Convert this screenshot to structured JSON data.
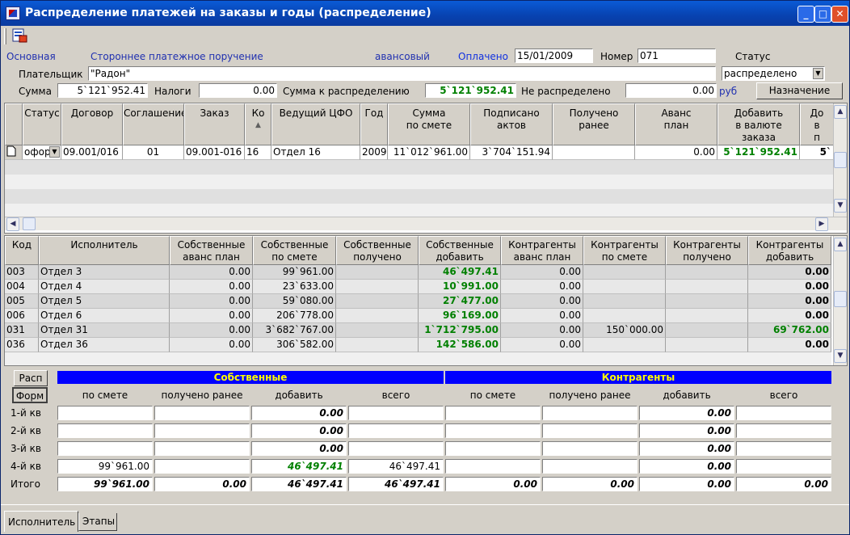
{
  "window": {
    "title": "Распределение платежей на заказы и годы (распределение)"
  },
  "colors": {
    "title_bar": "#0a46c0",
    "green_value": "#008000",
    "section_bar": "#0000ff",
    "section_text": "#ffff00",
    "link_blue": "#2030b0"
  },
  "toolbar": {
    "icon": "report-icon"
  },
  "header": {
    "tab_main": "Основная",
    "tab_third_party": "Стороннее платежное поручение",
    "advance_label": "авансовый",
    "paid_label": "Оплачено",
    "paid_date": "15/01/2009",
    "number_label": "Номер",
    "number_value": "071",
    "status_label": "Статус",
    "status_value": "распределено",
    "payer_label": "Плательщик",
    "payer_value": "\"Радон\"",
    "sum_label": "Сумма",
    "sum_value": "5`121`952.41",
    "taxes_label": "Налоги",
    "taxes_value": "0.00",
    "sum_to_dist_label": "Сумма к распределению",
    "sum_to_dist_value": "5`121`952.41",
    "not_dist_label": "Не распределено",
    "not_dist_value": "0.00",
    "currency": "руб",
    "assign_button": "Назначение"
  },
  "orders_grid": {
    "headers": [
      "Статус",
      "Договор",
      "Соглашение",
      "Заказ",
      "Ко",
      "Ведущий ЦФО",
      "Год",
      "Сумма\nпо смете",
      "Подписано\nактов",
      "Получено\nранее",
      "Аванс\nплан",
      "Добавить\nв валюте\nзаказа",
      "До\nв\nп"
    ],
    "row": {
      "status": "офор!",
      "contract": "09.001/016",
      "agreement": "01",
      "order": "09.001-016",
      "ko": "16",
      "cfo": "Отдел 16",
      "year": "2009",
      "sum_estimate": "11`012`961.00",
      "signed_acts": "3`704`151.94",
      "received": "",
      "advance_plan": "0.00",
      "add_currency": "5`121`952.41",
      "last": "5`"
    }
  },
  "exec_grid": {
    "headers": [
      "Код",
      "Исполнитель",
      "Собственные\nаванс план",
      "Собственные\nпо смете",
      "Собственные\nполучено",
      "Собственные\nдобавить",
      "Контрагенты\nаванс план",
      "Контрагенты\nпо смете",
      "Контрагенты\nполучено",
      "Контрагенты\nдобавить"
    ],
    "rows": [
      {
        "code": "003",
        "name": "Отдел 3",
        "own_adv": "0.00",
        "own_est": "99`961.00",
        "own_rec": "",
        "own_add": "46`497.41",
        "ctr_adv": "0.00",
        "ctr_est": "",
        "ctr_rec": "",
        "ctr_add": "0.00"
      },
      {
        "code": "004",
        "name": "Отдел 4",
        "own_adv": "0.00",
        "own_est": "23`633.00",
        "own_rec": "",
        "own_add": "10`991.00",
        "ctr_adv": "0.00",
        "ctr_est": "",
        "ctr_rec": "",
        "ctr_add": "0.00"
      },
      {
        "code": "005",
        "name": "Отдел 5",
        "own_adv": "0.00",
        "own_est": "59`080.00",
        "own_rec": "",
        "own_add": "27`477.00",
        "ctr_adv": "0.00",
        "ctr_est": "",
        "ctr_rec": "",
        "ctr_add": "0.00"
      },
      {
        "code": "006",
        "name": "Отдел 6",
        "own_adv": "0.00",
        "own_est": "206`778.00",
        "own_rec": "",
        "own_add": "96`169.00",
        "ctr_adv": "0.00",
        "ctr_est": "",
        "ctr_rec": "",
        "ctr_add": "0.00"
      },
      {
        "code": "031",
        "name": "Отдел 31",
        "own_adv": "0.00",
        "own_est": "3`682`767.00",
        "own_rec": "",
        "own_add": "1`712`795.00",
        "ctr_adv": "0.00",
        "ctr_est": "150`000.00",
        "ctr_rec": "",
        "ctr_add": "69`762.00"
      },
      {
        "code": "036",
        "name": "Отдел 36",
        "own_adv": "0.00",
        "own_est": "306`582.00",
        "own_rec": "",
        "own_add": "142`586.00",
        "ctr_adv": "0.00",
        "ctr_est": "",
        "ctr_rec": "",
        "ctr_add": "0.00"
      }
    ]
  },
  "summary": {
    "btn_rasp": "Расп",
    "btn_form": "Форм",
    "own_title": "Собственные",
    "ctr_title": "Контрагенты",
    "col_headers": [
      "по смете",
      "получено ранее",
      "добавить",
      "всего",
      "по смете",
      "получено ранее",
      "добавить",
      "всего"
    ],
    "rows": [
      {
        "label": "1-й кв",
        "values": [
          "",
          "",
          "0.00",
          "",
          "",
          "",
          "0.00",
          ""
        ]
      },
      {
        "label": "2-й кв",
        "values": [
          "",
          "",
          "0.00",
          "",
          "",
          "",
          "0.00",
          ""
        ]
      },
      {
        "label": "3-й кв",
        "values": [
          "",
          "",
          "0.00",
          "",
          "",
          "",
          "0.00",
          ""
        ]
      },
      {
        "label": "4-й кв",
        "values": [
          "99`961.00",
          "",
          "46`497.41",
          "46`497.41",
          "",
          "",
          "0.00",
          ""
        ]
      },
      {
        "label": "Итого",
        "values": [
          "99`961.00",
          "0.00",
          "46`497.41",
          "46`497.41",
          "0.00",
          "0.00",
          "0.00",
          "0.00"
        ]
      }
    ]
  },
  "bottom_tabs": [
    "Исполнитель",
    "Этапы"
  ]
}
